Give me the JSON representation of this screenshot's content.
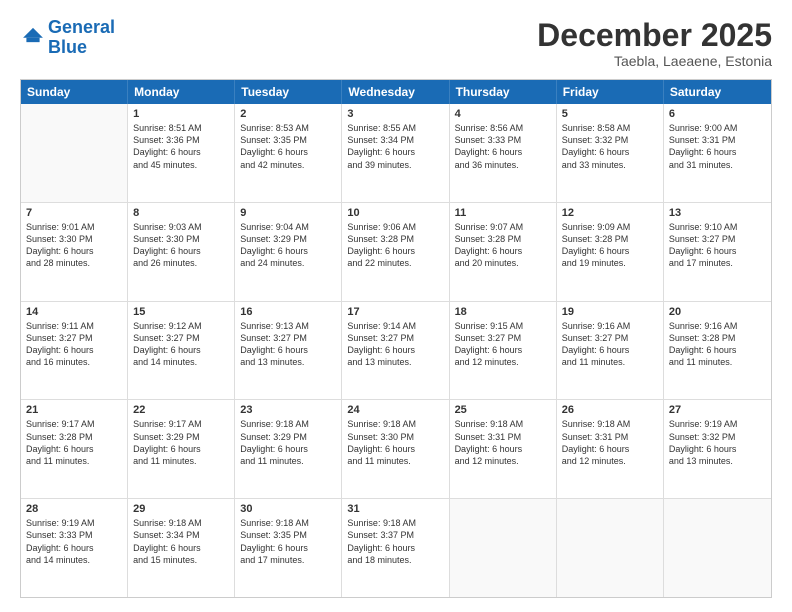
{
  "header": {
    "logo_line1": "General",
    "logo_line2": "Blue",
    "month_title": "December 2025",
    "location": "Taebla, Laeaene, Estonia"
  },
  "days_of_week": [
    "Sunday",
    "Monday",
    "Tuesday",
    "Wednesday",
    "Thursday",
    "Friday",
    "Saturday"
  ],
  "weeks": [
    [
      {
        "day": "",
        "info": ""
      },
      {
        "day": "1",
        "info": "Sunrise: 8:51 AM\nSunset: 3:36 PM\nDaylight: 6 hours\nand 45 minutes."
      },
      {
        "day": "2",
        "info": "Sunrise: 8:53 AM\nSunset: 3:35 PM\nDaylight: 6 hours\nand 42 minutes."
      },
      {
        "day": "3",
        "info": "Sunrise: 8:55 AM\nSunset: 3:34 PM\nDaylight: 6 hours\nand 39 minutes."
      },
      {
        "day": "4",
        "info": "Sunrise: 8:56 AM\nSunset: 3:33 PM\nDaylight: 6 hours\nand 36 minutes."
      },
      {
        "day": "5",
        "info": "Sunrise: 8:58 AM\nSunset: 3:32 PM\nDaylight: 6 hours\nand 33 minutes."
      },
      {
        "day": "6",
        "info": "Sunrise: 9:00 AM\nSunset: 3:31 PM\nDaylight: 6 hours\nand 31 minutes."
      }
    ],
    [
      {
        "day": "7",
        "info": "Sunrise: 9:01 AM\nSunset: 3:30 PM\nDaylight: 6 hours\nand 28 minutes."
      },
      {
        "day": "8",
        "info": "Sunrise: 9:03 AM\nSunset: 3:30 PM\nDaylight: 6 hours\nand 26 minutes."
      },
      {
        "day": "9",
        "info": "Sunrise: 9:04 AM\nSunset: 3:29 PM\nDaylight: 6 hours\nand 24 minutes."
      },
      {
        "day": "10",
        "info": "Sunrise: 9:06 AM\nSunset: 3:28 PM\nDaylight: 6 hours\nand 22 minutes."
      },
      {
        "day": "11",
        "info": "Sunrise: 9:07 AM\nSunset: 3:28 PM\nDaylight: 6 hours\nand 20 minutes."
      },
      {
        "day": "12",
        "info": "Sunrise: 9:09 AM\nSunset: 3:28 PM\nDaylight: 6 hours\nand 19 minutes."
      },
      {
        "day": "13",
        "info": "Sunrise: 9:10 AM\nSunset: 3:27 PM\nDaylight: 6 hours\nand 17 minutes."
      }
    ],
    [
      {
        "day": "14",
        "info": "Sunrise: 9:11 AM\nSunset: 3:27 PM\nDaylight: 6 hours\nand 16 minutes."
      },
      {
        "day": "15",
        "info": "Sunrise: 9:12 AM\nSunset: 3:27 PM\nDaylight: 6 hours\nand 14 minutes."
      },
      {
        "day": "16",
        "info": "Sunrise: 9:13 AM\nSunset: 3:27 PM\nDaylight: 6 hours\nand 13 minutes."
      },
      {
        "day": "17",
        "info": "Sunrise: 9:14 AM\nSunset: 3:27 PM\nDaylight: 6 hours\nand 13 minutes."
      },
      {
        "day": "18",
        "info": "Sunrise: 9:15 AM\nSunset: 3:27 PM\nDaylight: 6 hours\nand 12 minutes."
      },
      {
        "day": "19",
        "info": "Sunrise: 9:16 AM\nSunset: 3:27 PM\nDaylight: 6 hours\nand 11 minutes."
      },
      {
        "day": "20",
        "info": "Sunrise: 9:16 AM\nSunset: 3:28 PM\nDaylight: 6 hours\nand 11 minutes."
      }
    ],
    [
      {
        "day": "21",
        "info": "Sunrise: 9:17 AM\nSunset: 3:28 PM\nDaylight: 6 hours\nand 11 minutes."
      },
      {
        "day": "22",
        "info": "Sunrise: 9:17 AM\nSunset: 3:29 PM\nDaylight: 6 hours\nand 11 minutes."
      },
      {
        "day": "23",
        "info": "Sunrise: 9:18 AM\nSunset: 3:29 PM\nDaylight: 6 hours\nand 11 minutes."
      },
      {
        "day": "24",
        "info": "Sunrise: 9:18 AM\nSunset: 3:30 PM\nDaylight: 6 hours\nand 11 minutes."
      },
      {
        "day": "25",
        "info": "Sunrise: 9:18 AM\nSunset: 3:31 PM\nDaylight: 6 hours\nand 12 minutes."
      },
      {
        "day": "26",
        "info": "Sunrise: 9:18 AM\nSunset: 3:31 PM\nDaylight: 6 hours\nand 12 minutes."
      },
      {
        "day": "27",
        "info": "Sunrise: 9:19 AM\nSunset: 3:32 PM\nDaylight: 6 hours\nand 13 minutes."
      }
    ],
    [
      {
        "day": "28",
        "info": "Sunrise: 9:19 AM\nSunset: 3:33 PM\nDaylight: 6 hours\nand 14 minutes."
      },
      {
        "day": "29",
        "info": "Sunrise: 9:18 AM\nSunset: 3:34 PM\nDaylight: 6 hours\nand 15 minutes."
      },
      {
        "day": "30",
        "info": "Sunrise: 9:18 AM\nSunset: 3:35 PM\nDaylight: 6 hours\nand 17 minutes."
      },
      {
        "day": "31",
        "info": "Sunrise: 9:18 AM\nSunset: 3:37 PM\nDaylight: 6 hours\nand 18 minutes."
      },
      {
        "day": "",
        "info": ""
      },
      {
        "day": "",
        "info": ""
      },
      {
        "day": "",
        "info": ""
      }
    ]
  ]
}
